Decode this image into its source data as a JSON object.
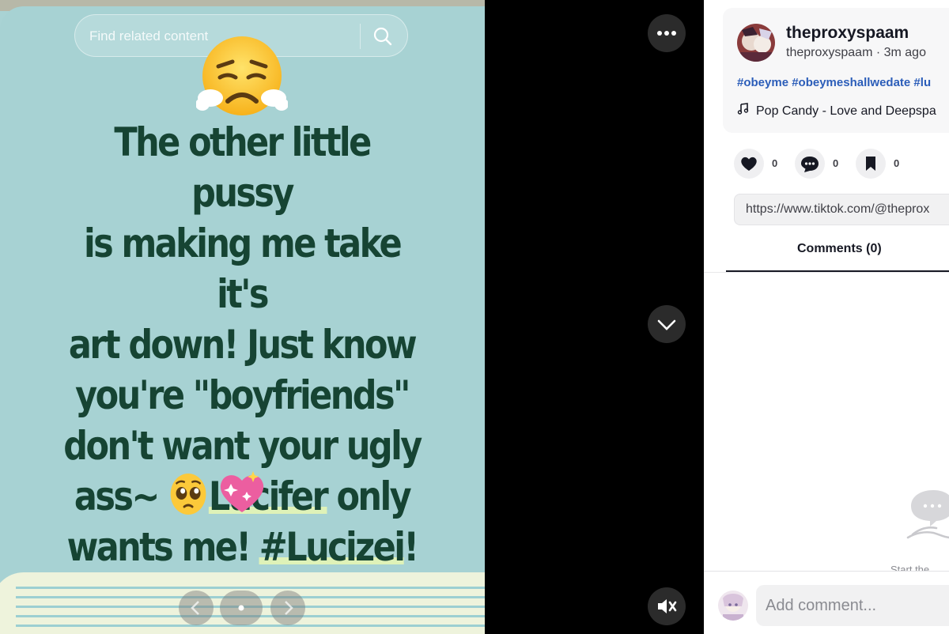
{
  "search": {
    "placeholder": "Find related content",
    "icon": "search-icon"
  },
  "post": {
    "caption_lines": [
      "The other little pussy",
      "is making me take it's",
      "art down! Just know",
      "you're \"boyfriends\"",
      "don't want your ugly"
    ],
    "caption_line6_a": "ass~ ",
    "caption_line6_b": "Lucifer",
    "caption_line6_c": " only",
    "caption_line7_a": "wants me! ",
    "caption_line7_b": "#Lucizei",
    "caption_line7_c": "!",
    "emojis": [
      "steam-from-nose-emoji",
      "pleading-face-emoji",
      "sparkling-heart-emoji"
    ],
    "colors": {
      "background": "#a7d2d3",
      "text": "#164433",
      "highlight": "#dff2b8"
    }
  },
  "player": {
    "more_icon": "more-horizontal-icon",
    "down_icon": "chevron-down-icon",
    "mute_icon": "volume-muted-icon",
    "carousel": [
      "prev-arrow-icon",
      "dot-indicator",
      "next-arrow-icon"
    ]
  },
  "author": {
    "name": "theproxyspaam",
    "meta": "theproxyspaam · 3m ago"
  },
  "description": {
    "hashtags": "#obeyme #obeymeshallwedate #lu",
    "music": "Pop Candy - Love and Deepspa"
  },
  "actions": {
    "likes": "0",
    "comments": "0",
    "saves": "0"
  },
  "share_link": "https://www.tiktok.com/@theprox",
  "tabs": {
    "comments": "Comments (0)"
  },
  "empty_state": {
    "text": "Start the"
  },
  "comment_box": {
    "placeholder": "Add comment..."
  }
}
